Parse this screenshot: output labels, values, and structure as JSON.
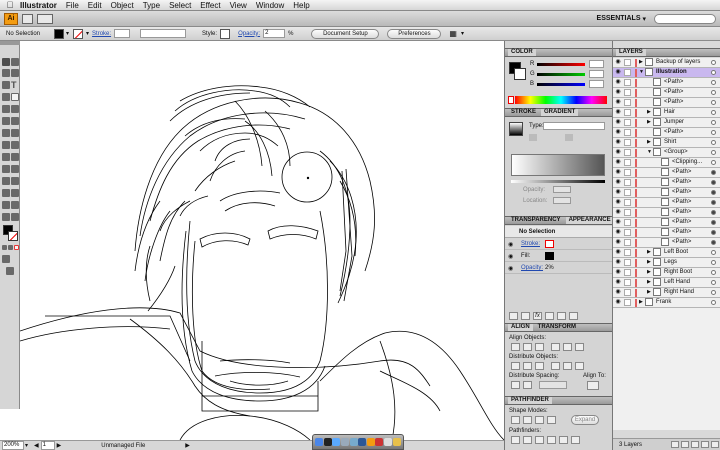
{
  "menubar": {
    "apple_icon": "apple-icon",
    "app_name": "Illustrator",
    "items": [
      "File",
      "Edit",
      "Object",
      "Type",
      "Select",
      "Effect",
      "View",
      "Window",
      "Help"
    ]
  },
  "appbar": {
    "logo": "Ai",
    "workspace": "ESSENTIALS"
  },
  "control_bar": {
    "selection": "No Selection",
    "stroke_label": "Stroke:",
    "style_label": "Style:",
    "opacity_label": "Opacity:",
    "opacity_value": "2",
    "opacity_unit": "%",
    "document_setup": "Document Setup",
    "preferences": "Preferences"
  },
  "status_bar": {
    "zoom": "200%",
    "page": "1",
    "status": "Unmanaged File"
  },
  "color_panel": {
    "tab": "COLOR",
    "channels": [
      "R",
      "G",
      "B"
    ]
  },
  "gradient_panel": {
    "tabs": [
      "STROKE",
      "GRADIENT"
    ],
    "type_label": "Type:",
    "opacity_label": "Opacity:",
    "location_label": "Location:"
  },
  "appearance_panel": {
    "tabs": [
      "TRANSPARENCY",
      "APPEARANCE"
    ],
    "title": "No Selection",
    "rows": [
      "Stroke:",
      "Fill:",
      "Opacity:"
    ],
    "opacity_value": "2%",
    "fx_label": "fx"
  },
  "align_panel": {
    "tabs": [
      "ALIGN",
      "TRANSFORM"
    ],
    "align_objects": "Align Objects:",
    "distribute_objects": "Distribute Objects:",
    "distribute_spacing": "Distribute Spacing:",
    "align_to": "Align To:"
  },
  "pathfinder_panel": {
    "tab": "PATHFINDER",
    "shape_modes": "Shape Modes:",
    "expand": "Expand",
    "pathfinders": "Pathfinders:"
  },
  "layers_panel": {
    "tab": "LAYERS",
    "footer": "3 Layers",
    "rows": [
      {
        "name": "Backup of layers",
        "indent": 0,
        "dot": "empty"
      },
      {
        "name": "Illustration",
        "indent": 0,
        "dot": "empty",
        "selected": true
      },
      {
        "name": "<Path>",
        "indent": 1,
        "dot": "empty"
      },
      {
        "name": "<Path>",
        "indent": 1,
        "dot": "empty"
      },
      {
        "name": "<Path>",
        "indent": 1,
        "dot": "empty"
      },
      {
        "name": "Hair",
        "indent": 1,
        "dot": "empty"
      },
      {
        "name": "Jumper",
        "indent": 1,
        "dot": "empty"
      },
      {
        "name": "<Path>",
        "indent": 1,
        "dot": "empty"
      },
      {
        "name": "Shirt",
        "indent": 1,
        "dot": "empty"
      },
      {
        "name": "<Group>",
        "indent": 1,
        "dot": "empty"
      },
      {
        "name": "<Clipping...",
        "indent": 2,
        "dot": "empty"
      },
      {
        "name": "<Path>",
        "indent": 2,
        "dot": "fill"
      },
      {
        "name": "<Path>",
        "indent": 2,
        "dot": "fill"
      },
      {
        "name": "<Path>",
        "indent": 2,
        "dot": "fill"
      },
      {
        "name": "<Path>",
        "indent": 2,
        "dot": "fill"
      },
      {
        "name": "<Path>",
        "indent": 2,
        "dot": "fill"
      },
      {
        "name": "<Path>",
        "indent": 2,
        "dot": "fill"
      },
      {
        "name": "<Path>",
        "indent": 2,
        "dot": "fill"
      },
      {
        "name": "<Path>",
        "indent": 2,
        "dot": "fill"
      },
      {
        "name": "Left Boot",
        "indent": 1,
        "dot": "empty"
      },
      {
        "name": "Legs",
        "indent": 1,
        "dot": "empty"
      },
      {
        "name": "Right Boot",
        "indent": 1,
        "dot": "empty"
      },
      {
        "name": "Left Hand",
        "indent": 1,
        "dot": "empty"
      },
      {
        "name": "Right Hand",
        "indent": 1,
        "dot": "empty"
      },
      {
        "name": "Frank",
        "indent": 0,
        "dot": "empty"
      }
    ]
  },
  "colors": {
    "layer_color": "#e06060",
    "selected_row": "#c9b8ef"
  }
}
